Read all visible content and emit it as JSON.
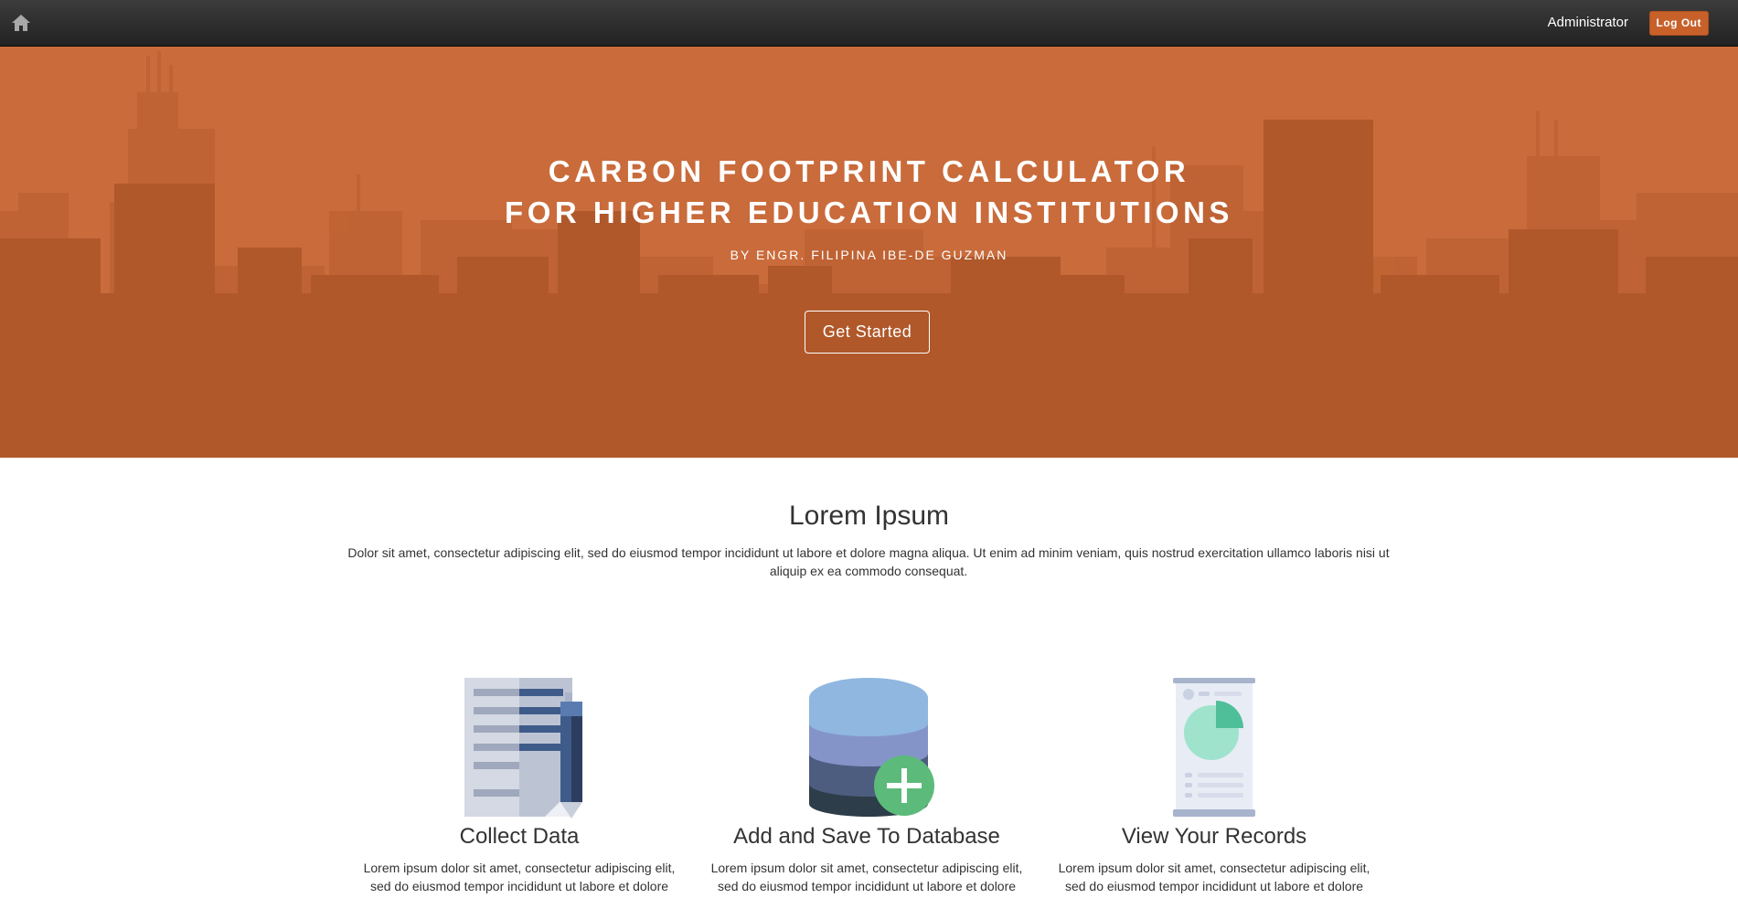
{
  "navbar": {
    "home_icon": "home-icon",
    "admin_label": "Administrator",
    "logout_label": "Log Out"
  },
  "hero": {
    "title_line1": "CARBON FOOTPRINT CALCULATOR",
    "title_line2": "FOR HIGHER EDUCATION INSTITUTIONS",
    "subtitle": "BY ENGR. FILIPINA IBE-DE GUZMAN",
    "button_label": "Get Started"
  },
  "intro": {
    "title": "Lorem Ipsum",
    "text": "Dolor sit amet, consectetur adipiscing elit, sed do eiusmod tempor incididunt ut labore et dolore magna aliqua. Ut enim ad minim veniam, quis nostrud exercitation ullamco laboris nisi ut aliquip ex ea commodo consequat."
  },
  "features": [
    {
      "icon": "document-pen-icon",
      "title": "Collect Data",
      "text": "Lorem ipsum dolor sit amet, consectetur adipiscing elit, sed do eiusmod tempor incididunt ut labore et dolore"
    },
    {
      "icon": "database-add-icon",
      "title": "Add and Save To Database",
      "text": "Lorem ipsum dolor sit amet, consectetur adipiscing elit, sed do eiusmod tempor incididunt ut labore et dolore"
    },
    {
      "icon": "report-chart-icon",
      "title": "View Your Records",
      "text": "Lorem ipsum dolor sit amet, consectetur adipiscing elit, sed do eiusmod tempor incididunt ut labore et dolore"
    }
  ],
  "colors": {
    "hero_bg": "#c96b3b",
    "skyline": "#b0582a",
    "navbar": "#2b2b2b",
    "logout_btn": "#c8602a"
  }
}
